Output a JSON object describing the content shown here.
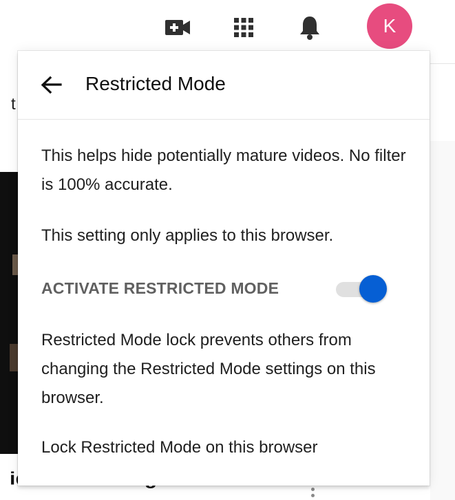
{
  "colors": {
    "avatar_bg": "#e74c7f",
    "toggle_on": "#065fd4",
    "icon": "#303030"
  },
  "topbar": {
    "create_icon": "video-camera-plus-icon",
    "apps_icon": "apps-grid-icon",
    "notifications_icon": "bell-icon",
    "avatar_letter": "K"
  },
  "background": {
    "left_fragment": "t",
    "bottom_title": "ideo with Morgan Freeman"
  },
  "panel": {
    "back_icon": "arrow-back-icon",
    "title": "Restricted Mode",
    "description": "This helps hide potentially mature videos. No filter is 100% accurate.",
    "browser_note": "This setting only applies to this browser.",
    "toggle_label": "ACTIVATE RESTRICTED MODE",
    "toggle_on": true,
    "lock_description": "Restricted Mode lock prevents others from changing the Restricted Mode settings on this browser.",
    "lock_link": "Lock Restricted Mode on this browser"
  }
}
